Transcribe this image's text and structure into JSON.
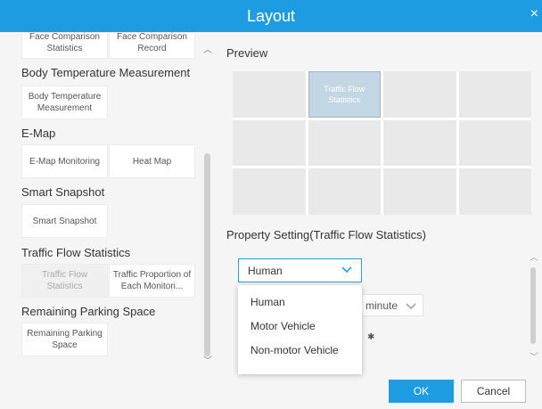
{
  "window": {
    "title": "Layout",
    "close_glyph": "×"
  },
  "left_panel": {
    "top_tiles": [
      "Face Comparison Statistics",
      "Face Comparison Record"
    ],
    "categories": [
      {
        "name": "Body Temperature Measurement",
        "tiles": [
          "Body Temperature Measurement"
        ]
      },
      {
        "name": "E-Map",
        "tiles": [
          "E-Map Monitoring",
          "Heat Map"
        ]
      },
      {
        "name": "Smart Snapshot",
        "tiles": [
          "Smart Snapshot"
        ]
      },
      {
        "name": "Traffic Flow Statistics",
        "tiles": [
          "Traffic Flow Statistics",
          "Traffic Proportion of Each Monitori..."
        ]
      },
      {
        "name": "Remaining Parking Space",
        "tiles": [
          "Remaining Parking Space"
        ]
      }
    ]
  },
  "preview": {
    "label": "Preview",
    "active_cell_label": "Traffic Flow Statistics"
  },
  "property": {
    "label": "Property Setting(Traffic Flow Statistics)",
    "target_select_value": "Human",
    "interval_select_value": "minute",
    "target_options": [
      "Human",
      "Motor Vehicle",
      "Non-motor Vehicle"
    ]
  },
  "buttons": {
    "ok": "OK",
    "cancel": "Cancel"
  },
  "colors": {
    "accent": "#1e9ce2",
    "active_cell": "#c2d6e3"
  },
  "icons": {
    "close": "close-icon",
    "chevron": "chevron-down-icon",
    "gear": "gear-icon"
  }
}
